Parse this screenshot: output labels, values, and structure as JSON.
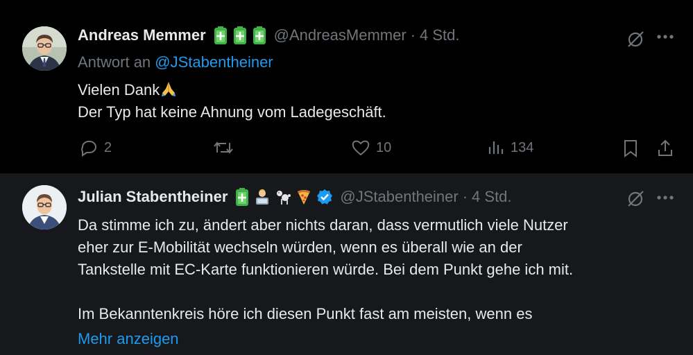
{
  "tweet1": {
    "author_name": "Andreas Memmer",
    "handle": "@AndreasMemmer",
    "time": "4 Std.",
    "reply_prefix": "Antwort an",
    "reply_handle": "@JStabentheiner",
    "line1": "Vielen Dank",
    "line2": "Der Typ hat keine Ahnung vom Ladegeschäft.",
    "replies": "2",
    "likes": "10",
    "views": "134",
    "badge_icons": [
      "battery-icon",
      "battery-icon",
      "battery-icon"
    ]
  },
  "tweet2": {
    "author_name": "Julian Stabentheiner",
    "handle": "@JStabentheiner",
    "time": "4 Std.",
    "lines": [
      "Da stimme ich zu, ändert aber nichts daran, dass vermutlich viele Nutzer",
      "eher zur E-Mobilität wechseln würden, wenn es überall wie an der",
      "Tankstelle mit EC-Karte funktionieren würde. Bei dem Punkt gehe ich mit.",
      "",
      "Im Bekanntenkreis höre ich diesen Punkt fast am meisten, wenn es"
    ],
    "show_more": "Mehr anzeigen",
    "badge_icons": [
      "battery-icon",
      "technologist-icon",
      "poodle-icon",
      "pizza-icon",
      "verified-badge-icon"
    ]
  },
  "separator": "·",
  "colors": {
    "background": "#000000",
    "highlight_background": "#16181c",
    "text": "#e7e9ea",
    "secondary": "#71767b",
    "link": "#1d9bf0",
    "battery_green": "#3fb24a"
  }
}
